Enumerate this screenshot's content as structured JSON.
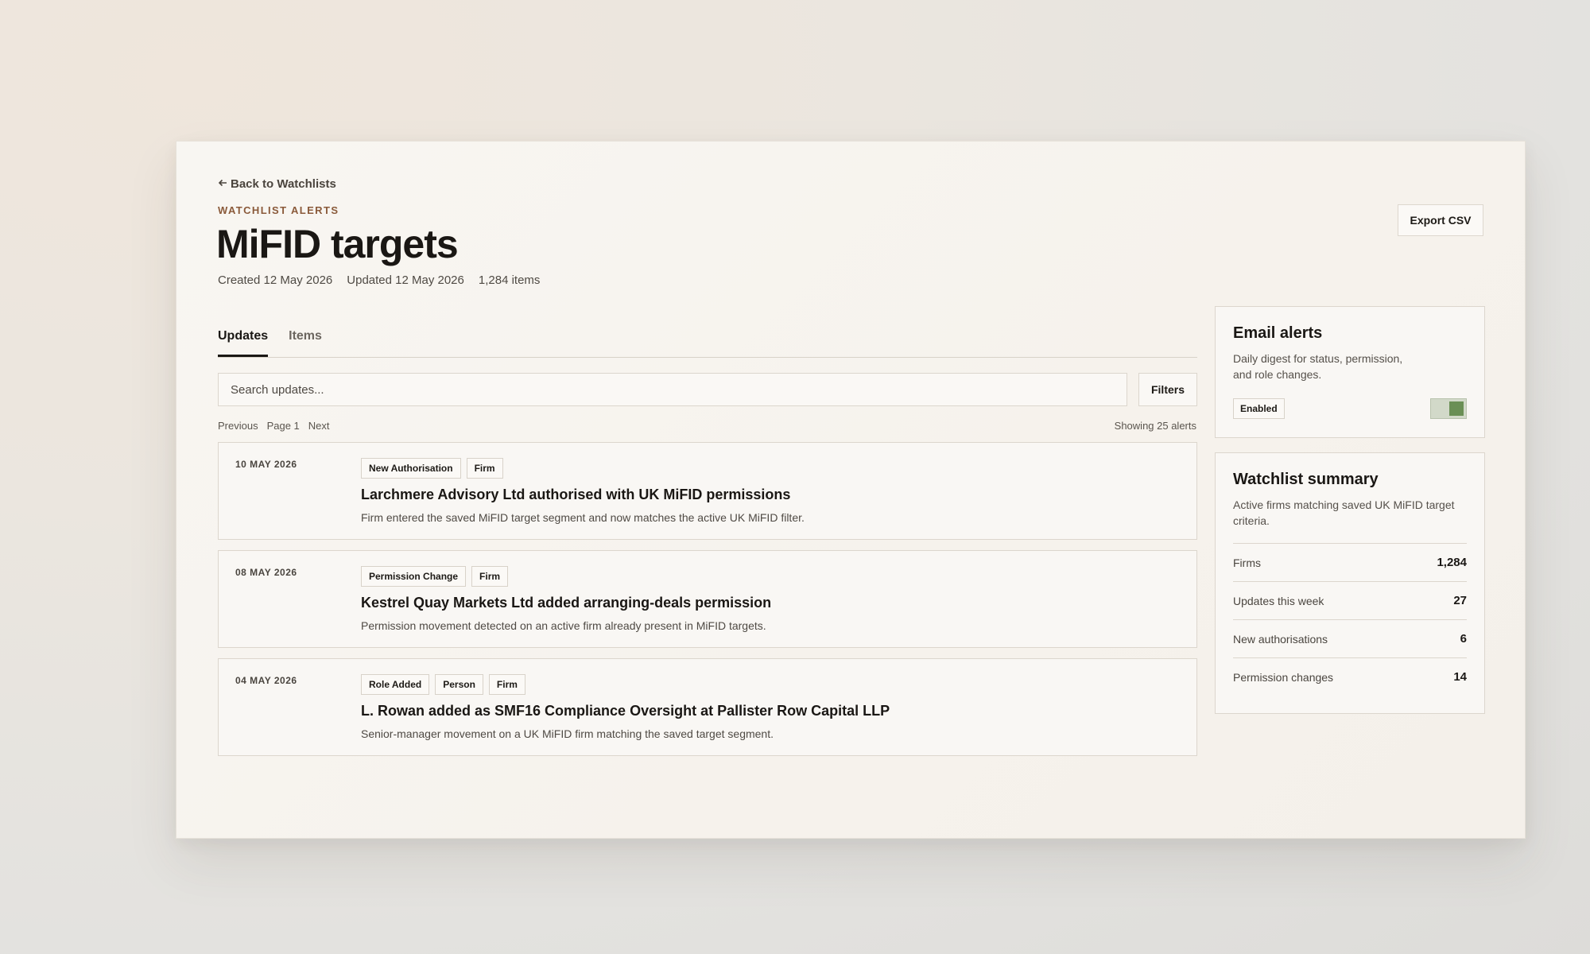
{
  "nav": {
    "back_label": "Back to Watchlists"
  },
  "header": {
    "eyebrow": "WATCHLIST ALERTS",
    "title": "MiFID targets",
    "created": "Created 12 May 2026",
    "updated": "Updated 12 May 2026",
    "items_count": "1,284 items",
    "export_label": "Export CSV"
  },
  "tabs": [
    {
      "label": "Updates",
      "active": true
    },
    {
      "label": "Items",
      "active": false
    }
  ],
  "search": {
    "placeholder": "Search updates...",
    "value": ""
  },
  "filters_label": "Filters",
  "pagination": {
    "previous": "Previous",
    "page": "Page 1",
    "next": "Next"
  },
  "showing": "Showing 25 alerts",
  "alerts": [
    {
      "date": "10 MAY 2026",
      "tags": [
        "New Authorisation",
        "Firm"
      ],
      "title": "Larchmere Advisory Ltd authorised with UK MiFID permissions",
      "description": "Firm entered the saved MiFID target segment and now matches the active UK MiFID filter."
    },
    {
      "date": "08 MAY 2026",
      "tags": [
        "Permission Change",
        "Firm"
      ],
      "title": "Kestrel Quay Markets Ltd added arranging-deals permission",
      "description": "Permission movement detected on an active firm already present in MiFID targets."
    },
    {
      "date": "04 MAY 2026",
      "tags": [
        "Role Added",
        "Person",
        "Firm"
      ],
      "title": "L. Rowan added as SMF16 Compliance Oversight at Pallister Row Capital LLP",
      "description": "Senior-manager movement on a UK MiFID firm matching the saved target segment."
    }
  ],
  "email_alerts": {
    "title": "Email alerts",
    "description": "Daily digest for status, permission, and role changes.",
    "status": "Enabled",
    "toggle_on": true,
    "toggle_color": "#6a8f55"
  },
  "summary": {
    "title": "Watchlist summary",
    "description": "Active firms matching saved UK MiFID target criteria.",
    "stats": [
      {
        "label": "Firms",
        "value": "1,284"
      },
      {
        "label": "Updates this week",
        "value": "27"
      },
      {
        "label": "New authorisations",
        "value": "6"
      },
      {
        "label": "Permission changes",
        "value": "14"
      }
    ]
  },
  "colors": {
    "accent": "#8a5a3a",
    "toggle_on": "#6a8f55",
    "text": "#1a1714"
  }
}
